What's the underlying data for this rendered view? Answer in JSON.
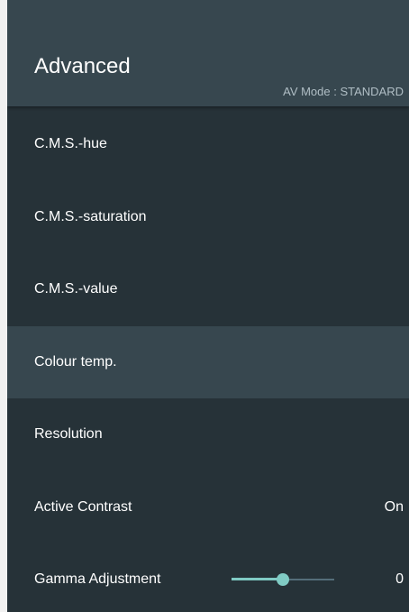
{
  "header": {
    "title": "Advanced",
    "subtitle": "AV Mode : STANDARD"
  },
  "items": [
    {
      "label": "C.M.S.-hue"
    },
    {
      "label": "C.M.S.-saturation"
    },
    {
      "label": "C.M.S.-value"
    },
    {
      "label": "Colour temp.",
      "selected": true
    },
    {
      "label": "Resolution"
    },
    {
      "label": "Active Contrast",
      "value": "On"
    },
    {
      "label": "Gamma Adjustment",
      "value": "0",
      "slider_level": 0.5
    }
  ],
  "colors": {
    "background": "#263238",
    "header": "#37474f",
    "selected": "#37474f",
    "accent": "#80cbc4"
  }
}
